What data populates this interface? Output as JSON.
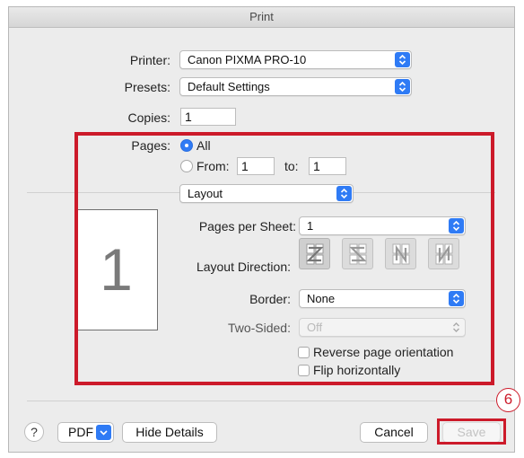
{
  "window": {
    "title": "Print"
  },
  "printer": {
    "label": "Printer:",
    "value": "Canon PIXMA PRO-10"
  },
  "presets": {
    "label": "Presets:",
    "value": "Default Settings"
  },
  "copies": {
    "label": "Copies:",
    "value": "1"
  },
  "pages": {
    "label": "Pages:",
    "all_label": "All",
    "from_label": "From:",
    "from_value": "1",
    "to_label": "to:",
    "to_value": "1",
    "selected": "All"
  },
  "section": {
    "value": "Layout"
  },
  "preview": {
    "page_number": "1"
  },
  "layout": {
    "pages_per_sheet": {
      "label": "Pages per Sheet:",
      "value": "1"
    },
    "layout_direction": {
      "label": "Layout Direction:",
      "options": [
        "z-forward",
        "z-reverse",
        "n-forward",
        "n-reverse"
      ],
      "selected_index": 0
    },
    "border": {
      "label": "Border:",
      "value": "None"
    },
    "two_sided": {
      "label": "Two-Sided:",
      "value": "Off",
      "enabled": false
    },
    "reverse_orientation": {
      "label": "Reverse page orientation",
      "checked": false
    },
    "flip_horizontally": {
      "label": "Flip horizontally",
      "checked": false
    }
  },
  "footer": {
    "help_label": "?",
    "pdf_label": "PDF",
    "hide_details_label": "Hide Details",
    "cancel_label": "Cancel",
    "save_label": "Save"
  },
  "annotation": {
    "step_label": "6",
    "color": "#cc1a2a"
  },
  "colors": {
    "accent": "#2f7bf5",
    "highlight": "#cc1a2a"
  }
}
